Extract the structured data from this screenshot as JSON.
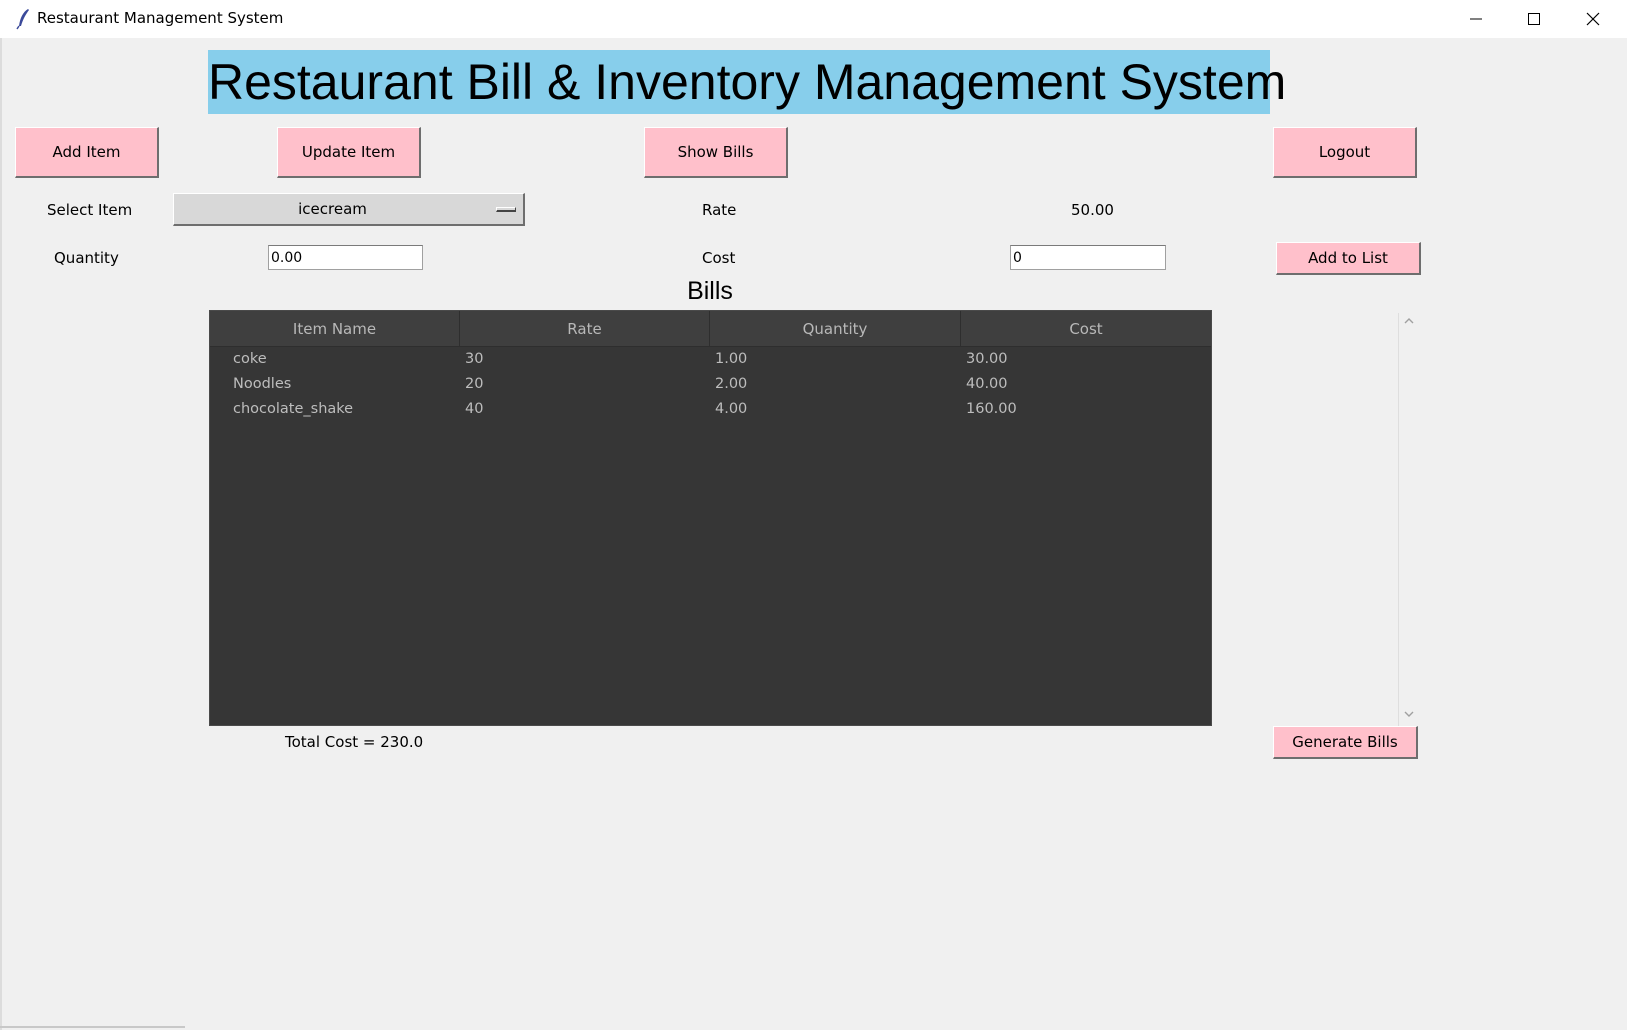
{
  "window": {
    "title": "Restaurant Management System",
    "icon": "feather-icon",
    "controls": [
      "minimize-icon",
      "maximize-icon",
      "close-icon"
    ]
  },
  "header": {
    "title": "Restaurant Bill & Inventory Management System",
    "background": "#87ceeb"
  },
  "toolbar": {
    "add_item": "Add Item",
    "update_item": "Update Item",
    "show_bills": "Show Bills",
    "logout": "Logout",
    "button_color": "#ffc0cb"
  },
  "form": {
    "select_item_label": "Select Item",
    "selected_item": "icecream",
    "rate_label": "Rate",
    "rate_value": "50.00",
    "quantity_label": "Quantity",
    "quantity_value": "0.00",
    "cost_label": "Cost",
    "cost_value": "0",
    "add_to_list": "Add to List"
  },
  "bills": {
    "title": "Bills",
    "columns": [
      "Item Name",
      "Rate",
      "Quantity",
      "Cost"
    ],
    "rows": [
      [
        "coke",
        "30",
        "1.00",
        "30.00"
      ],
      [
        "Noodles",
        "20",
        "2.00",
        "40.00"
      ],
      [
        "chocolate_shake",
        "40",
        "4.00",
        "160.00"
      ]
    ],
    "total": "Total Cost = 230.0",
    "generate": "Generate Bills",
    "table_background": "#363636"
  }
}
